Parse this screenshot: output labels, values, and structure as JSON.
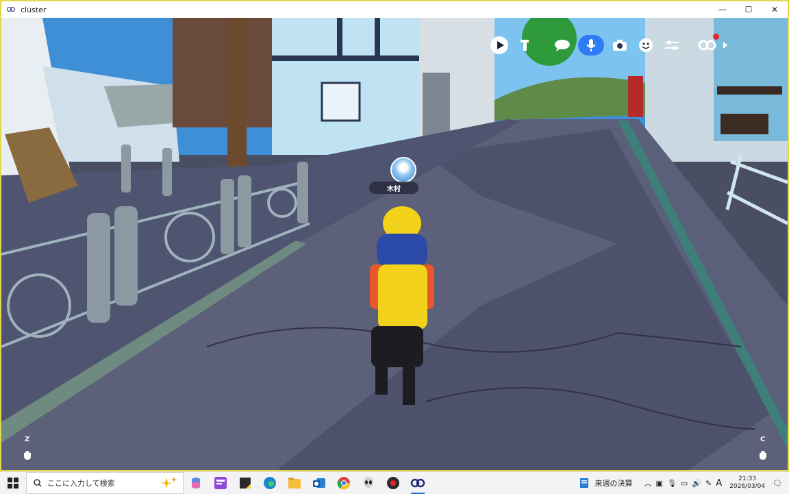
{
  "window": {
    "title": "cluster",
    "minimize_glyph": "—",
    "maximize_glyph": "☐",
    "close_glyph": "✕"
  },
  "hud": {
    "icons": [
      "play-icon",
      "emote-icon",
      "chat-icon",
      "mic-icon",
      "camera-icon",
      "face-icon",
      "settings-sliders-icon",
      "cluster-logo-icon"
    ],
    "mic_active_color": "#2f7bf5"
  },
  "player": {
    "name": "木村"
  },
  "controls": {
    "left_key": "Z",
    "right_key": "C"
  },
  "taskbar": {
    "search_placeholder": "ここに入力して検索",
    "weather_text": "来週の決算",
    "time": "21:33",
    "date": "2026/03/04",
    "ime_label": "A",
    "apps": [
      "copilot-icon",
      "news-icon",
      "sticky-notes-icon",
      "edge-icon",
      "file-explorer-icon",
      "outlook-icon",
      "chrome-icon",
      "alien-app-icon",
      "record-app-icon",
      "cluster-taskbar-icon"
    ]
  }
}
